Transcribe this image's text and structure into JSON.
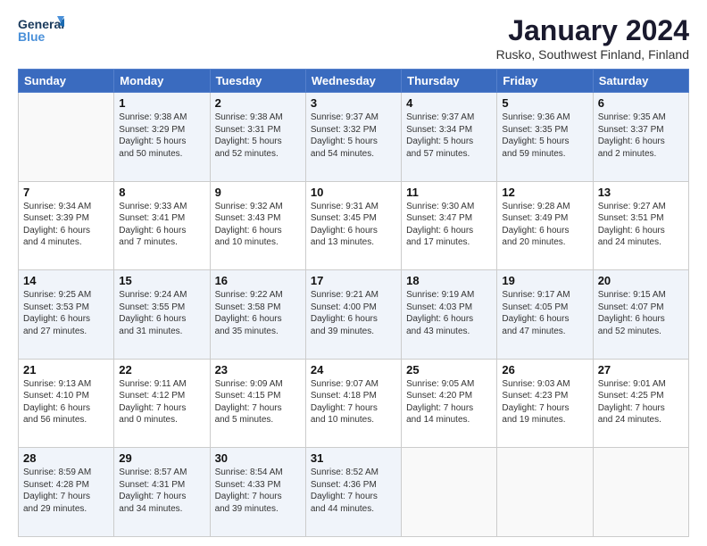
{
  "header": {
    "logo_line1": "General",
    "logo_line2": "Blue",
    "month_title": "January 2024",
    "location": "Rusko, Southwest Finland, Finland"
  },
  "days_of_week": [
    "Sunday",
    "Monday",
    "Tuesday",
    "Wednesday",
    "Thursday",
    "Friday",
    "Saturday"
  ],
  "weeks": [
    [
      {
        "day": "",
        "info": ""
      },
      {
        "day": "1",
        "info": "Sunrise: 9:38 AM\nSunset: 3:29 PM\nDaylight: 5 hours\nand 50 minutes."
      },
      {
        "day": "2",
        "info": "Sunrise: 9:38 AM\nSunset: 3:31 PM\nDaylight: 5 hours\nand 52 minutes."
      },
      {
        "day": "3",
        "info": "Sunrise: 9:37 AM\nSunset: 3:32 PM\nDaylight: 5 hours\nand 54 minutes."
      },
      {
        "day": "4",
        "info": "Sunrise: 9:37 AM\nSunset: 3:34 PM\nDaylight: 5 hours\nand 57 minutes."
      },
      {
        "day": "5",
        "info": "Sunrise: 9:36 AM\nSunset: 3:35 PM\nDaylight: 5 hours\nand 59 minutes."
      },
      {
        "day": "6",
        "info": "Sunrise: 9:35 AM\nSunset: 3:37 PM\nDaylight: 6 hours\nand 2 minutes."
      }
    ],
    [
      {
        "day": "7",
        "info": "Sunrise: 9:34 AM\nSunset: 3:39 PM\nDaylight: 6 hours\nand 4 minutes."
      },
      {
        "day": "8",
        "info": "Sunrise: 9:33 AM\nSunset: 3:41 PM\nDaylight: 6 hours\nand 7 minutes."
      },
      {
        "day": "9",
        "info": "Sunrise: 9:32 AM\nSunset: 3:43 PM\nDaylight: 6 hours\nand 10 minutes."
      },
      {
        "day": "10",
        "info": "Sunrise: 9:31 AM\nSunset: 3:45 PM\nDaylight: 6 hours\nand 13 minutes."
      },
      {
        "day": "11",
        "info": "Sunrise: 9:30 AM\nSunset: 3:47 PM\nDaylight: 6 hours\nand 17 minutes."
      },
      {
        "day": "12",
        "info": "Sunrise: 9:28 AM\nSunset: 3:49 PM\nDaylight: 6 hours\nand 20 minutes."
      },
      {
        "day": "13",
        "info": "Sunrise: 9:27 AM\nSunset: 3:51 PM\nDaylight: 6 hours\nand 24 minutes."
      }
    ],
    [
      {
        "day": "14",
        "info": "Sunrise: 9:25 AM\nSunset: 3:53 PM\nDaylight: 6 hours\nand 27 minutes."
      },
      {
        "day": "15",
        "info": "Sunrise: 9:24 AM\nSunset: 3:55 PM\nDaylight: 6 hours\nand 31 minutes."
      },
      {
        "day": "16",
        "info": "Sunrise: 9:22 AM\nSunset: 3:58 PM\nDaylight: 6 hours\nand 35 minutes."
      },
      {
        "day": "17",
        "info": "Sunrise: 9:21 AM\nSunset: 4:00 PM\nDaylight: 6 hours\nand 39 minutes."
      },
      {
        "day": "18",
        "info": "Sunrise: 9:19 AM\nSunset: 4:03 PM\nDaylight: 6 hours\nand 43 minutes."
      },
      {
        "day": "19",
        "info": "Sunrise: 9:17 AM\nSunset: 4:05 PM\nDaylight: 6 hours\nand 47 minutes."
      },
      {
        "day": "20",
        "info": "Sunrise: 9:15 AM\nSunset: 4:07 PM\nDaylight: 6 hours\nand 52 minutes."
      }
    ],
    [
      {
        "day": "21",
        "info": "Sunrise: 9:13 AM\nSunset: 4:10 PM\nDaylight: 6 hours\nand 56 minutes."
      },
      {
        "day": "22",
        "info": "Sunrise: 9:11 AM\nSunset: 4:12 PM\nDaylight: 7 hours\nand 0 minutes."
      },
      {
        "day": "23",
        "info": "Sunrise: 9:09 AM\nSunset: 4:15 PM\nDaylight: 7 hours\nand 5 minutes."
      },
      {
        "day": "24",
        "info": "Sunrise: 9:07 AM\nSunset: 4:18 PM\nDaylight: 7 hours\nand 10 minutes."
      },
      {
        "day": "25",
        "info": "Sunrise: 9:05 AM\nSunset: 4:20 PM\nDaylight: 7 hours\nand 14 minutes."
      },
      {
        "day": "26",
        "info": "Sunrise: 9:03 AM\nSunset: 4:23 PM\nDaylight: 7 hours\nand 19 minutes."
      },
      {
        "day": "27",
        "info": "Sunrise: 9:01 AM\nSunset: 4:25 PM\nDaylight: 7 hours\nand 24 minutes."
      }
    ],
    [
      {
        "day": "28",
        "info": "Sunrise: 8:59 AM\nSunset: 4:28 PM\nDaylight: 7 hours\nand 29 minutes."
      },
      {
        "day": "29",
        "info": "Sunrise: 8:57 AM\nSunset: 4:31 PM\nDaylight: 7 hours\nand 34 minutes."
      },
      {
        "day": "30",
        "info": "Sunrise: 8:54 AM\nSunset: 4:33 PM\nDaylight: 7 hours\nand 39 minutes."
      },
      {
        "day": "31",
        "info": "Sunrise: 8:52 AM\nSunset: 4:36 PM\nDaylight: 7 hours\nand 44 minutes."
      },
      {
        "day": "",
        "info": ""
      },
      {
        "day": "",
        "info": ""
      },
      {
        "day": "",
        "info": ""
      }
    ]
  ]
}
